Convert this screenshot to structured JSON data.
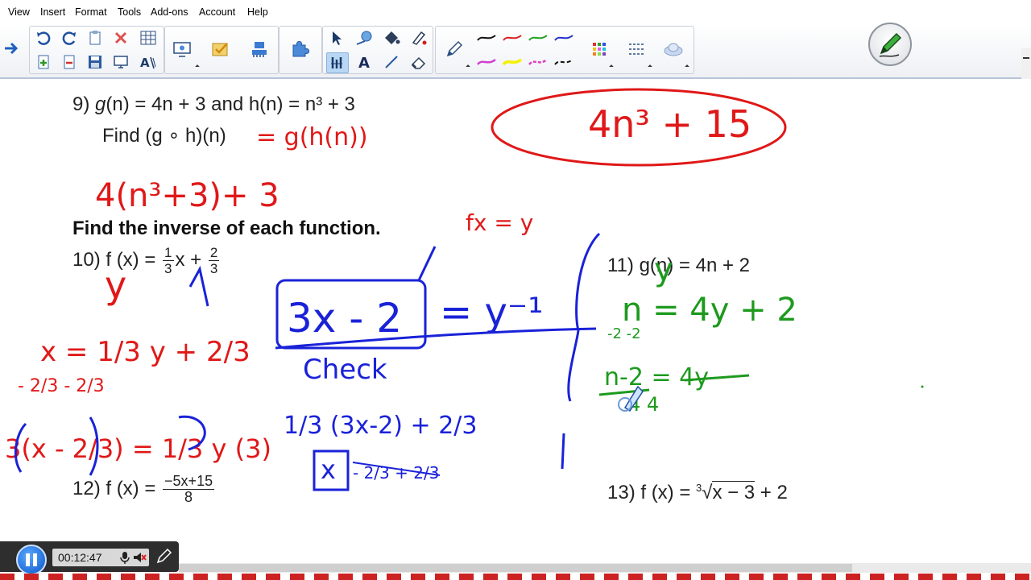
{
  "menu": [
    "View",
    "Insert",
    "Format",
    "Tools",
    "Add-ons",
    "Account",
    "Help"
  ],
  "toolbar_icons": {
    "row1": [
      "arrow-right-icon",
      "undo-icon",
      "redo-icon",
      "paste-icon",
      "delete-icon",
      "table-icon",
      "screen-capture-icon",
      "check-tool-icon",
      "network-icon",
      "puzzle-icon",
      "select-icon",
      "shape-icon",
      "fill-icon",
      "pen-fill-icon",
      "pencil-icon",
      "pen-black-icon",
      "pen-red-icon",
      "pen-green-icon",
      "pen-blue-icon",
      "color-grid-icon",
      "line-style-icon",
      "cloud-icon"
    ],
    "row2": [
      "add-page-icon",
      "remove-page-icon",
      "save-icon",
      "display-icon",
      "text-recognize-icon",
      "table-select-icon",
      "text-icon",
      "line-icon",
      "eraser-icon",
      "highlighter-magenta-icon",
      "highlighter-yellow-icon",
      "highlighter-pink-icon",
      "pen-dash-icon"
    ]
  },
  "colors": {
    "ink_red": "#e01818",
    "ink_blue": "#1a22d8",
    "ink_green": "#1d9a1d",
    "accent": "#1a6fdc"
  },
  "worksheet": {
    "q9_line1_num": "9)",
    "q9_g": "g",
    "q9_n": "n",
    "q9_rest1": "(n) = 4n + 3  and h(n) = n³ + 3",
    "q9_line2": "Find (g ∘ h)(n)",
    "heading": "Find the inverse of each function.",
    "q10_label": "10) f (x) = ",
    "q10_frac1_num": "1",
    "q10_frac1_den": "3",
    "q10_mid": "x + ",
    "q10_frac2_num": "2",
    "q10_frac2_den": "3",
    "q11": "11) g(n) = 4n + 2",
    "q12_label": "12) f (x) = ",
    "q12_num": "−5x+15",
    "q12_den": "8",
    "q13": "13) f (x) = ∛x − 3 + 2",
    "q13_label": "13) f (x) = ",
    "q13_index": "3",
    "q13_radicand": "x − 3",
    "q13_tail": " + 2"
  },
  "handwriting": {
    "answer_circle": "4n³ + 15",
    "composition": "= g(h(n))",
    "expansion": "4(n³+3)+ 3",
    "fx_y": "fx = y",
    "q10_y": "y",
    "q10_eq1": "x = 1/3 y + 2/3",
    "q10_sub": "- 2/3     - 2/3",
    "q10_mult": "3(x - 2/3) = 1/3 y (3)",
    "boxed": "3x - 2",
    "inverse": "= y⁻¹",
    "check": "Check",
    "check_line1": "1/3 (3x-2) + 2/3",
    "check_box": "x",
    "check_cancel": "- 2/3 + 2/3",
    "q11_y": "y",
    "q11_step1": "n = 4y + 2",
    "q11_step1_sub": "-2       -2",
    "q11_step2": "n-2 = 4y",
    "q11_step2_den": "4       4"
  },
  "player": {
    "timecode": "00:12:47"
  }
}
